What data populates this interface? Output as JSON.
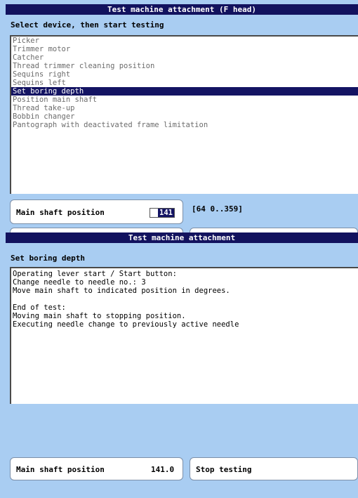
{
  "top_panel": {
    "title": "Test machine attachment (F head)",
    "instruction": "Select device, then start testing",
    "devices": [
      "Picker",
      "Trimmer motor",
      "Catcher",
      "Thread trimmer cleaning position",
      "Sequins right",
      "Sequins left",
      "Set boring depth",
      "Position main shaft",
      "Thread take-up",
      "Bobbin changer",
      "Pantograph with deactivated frame limitation"
    ],
    "selected_device": "Set boring depth",
    "main_shaft_label": "Main shaft position",
    "main_shaft_value": "141",
    "range_text": "[64  0..359]"
  },
  "bottom_panel": {
    "title": "Test machine attachment",
    "heading": "Set boring depth",
    "description_lines": [
      "Operating lever start / Start button:",
      "Change needle to needle no.: 3",
      "Move main shaft to indicated position in degrees.",
      "",
      "End of test:",
      "Moving main shaft to stopping position.",
      "Executing needle change to previously active needle"
    ],
    "main_shaft_label": "Main shaft position",
    "main_shaft_value": "141.0",
    "stop_label": "Stop testing"
  },
  "colors": {
    "background": "#a9cdf2",
    "title_bar": "#12125e",
    "selection": "#141463"
  }
}
